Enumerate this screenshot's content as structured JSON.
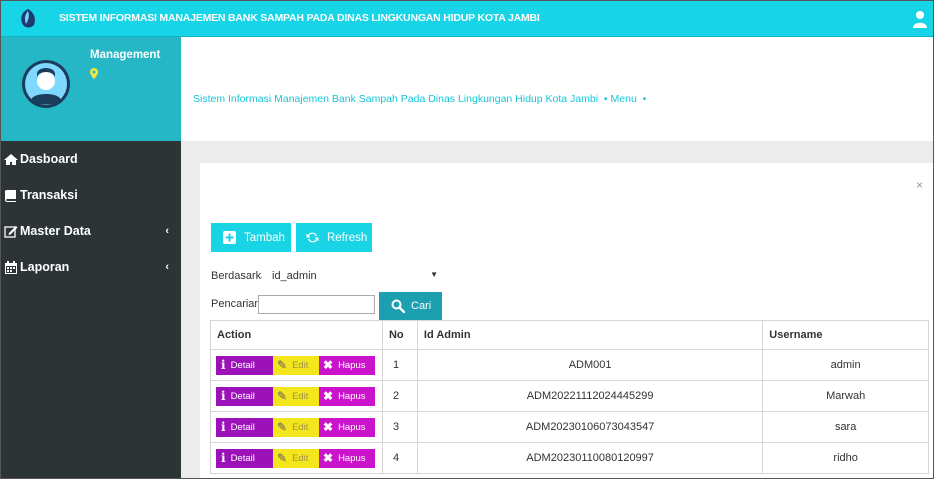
{
  "app": {
    "title": "SISTEM INFORMASI MANAJEMEN BANK SAMPAH PADA DINAS LINGKUNGAN HIDUP KOTA JAMBI"
  },
  "profile": {
    "name": "Management"
  },
  "sidebar": {
    "items": [
      {
        "label": "Dasboard",
        "icon": "home-icon",
        "has_submenu": false
      },
      {
        "label": "Transaksi",
        "icon": "book-icon",
        "has_submenu": false
      },
      {
        "label": "Master Data",
        "icon": "edit-icon",
        "has_submenu": true
      },
      {
        "label": "Laporan",
        "icon": "calendar-icon",
        "has_submenu": true
      }
    ],
    "chevron": "‹"
  },
  "breadcrumb": {
    "text": "Sistem Informasi Manajemen Bank Sampah Pada Dinas Lingkungan Hidup Kota Jambi",
    "separator": "•",
    "menu": "Menu"
  },
  "panel": {
    "close": "×",
    "add_label": "Tambah",
    "refresh_label": "Refresh",
    "filter_label": "Berdasarkan:",
    "filter_value": "id_admin",
    "search_label": "Pencarian",
    "search_value": "",
    "search_button": "Cari"
  },
  "table": {
    "columns": [
      "Action",
      "No",
      "Id Admin",
      "Username"
    ],
    "action_labels": {
      "detail": "Detail",
      "edit": "Edit",
      "hapus": "Hapus"
    },
    "rows": [
      {
        "no": "1",
        "id": "ADM001",
        "username": "admin"
      },
      {
        "no": "2",
        "id": "ADM20221112024445299",
        "username": "Marwah"
      },
      {
        "no": "3",
        "id": "ADM20230106073043547",
        "username": "sara"
      },
      {
        "no": "4",
        "id": "ADM20230110080120997",
        "username": "ridho"
      }
    ]
  },
  "colors": {
    "topbar": "#17d4e6",
    "sidebar": "#2d3436",
    "profile_bg": "#26b7c6",
    "detail": "#9b12b8",
    "edit": "#f4e61d",
    "hapus": "#cc13cc",
    "cari": "#1c9fae"
  }
}
